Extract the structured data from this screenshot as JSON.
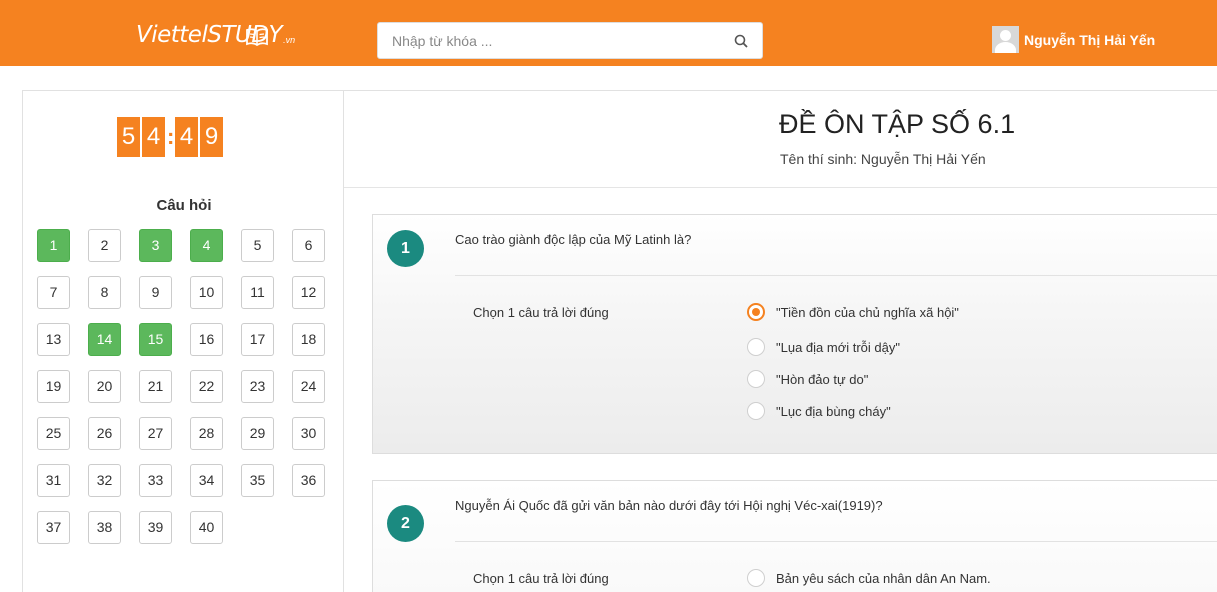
{
  "header": {
    "logo_main": "ViettelSTUDY",
    "logo_sub": ".vn",
    "search_placeholder": "Nhập từ khóa ...",
    "user_name": "Nguyễn Thị Hải Yến",
    "accent_color": "#f58220",
    "icons": [
      "book-icon",
      "search-icon",
      "avatar-icon"
    ]
  },
  "timer": {
    "d1": "5",
    "d2": "4",
    "sep": ":",
    "d3": "4",
    "d4": "9"
  },
  "question_nav": {
    "title": "Câu hỏi",
    "answered_color": "#5cb85c",
    "items": [
      {
        "n": "1",
        "done": true
      },
      {
        "n": "2",
        "done": false
      },
      {
        "n": "3",
        "done": true
      },
      {
        "n": "4",
        "done": true
      },
      {
        "n": "5",
        "done": false
      },
      {
        "n": "6",
        "done": false
      },
      {
        "n": "7",
        "done": false
      },
      {
        "n": "8",
        "done": false
      },
      {
        "n": "9",
        "done": false
      },
      {
        "n": "10",
        "done": false
      },
      {
        "n": "11",
        "done": false
      },
      {
        "n": "12",
        "done": false
      },
      {
        "n": "13",
        "done": false
      },
      {
        "n": "14",
        "done": true
      },
      {
        "n": "15",
        "done": true
      },
      {
        "n": "16",
        "done": false
      },
      {
        "n": "17",
        "done": false
      },
      {
        "n": "18",
        "done": false
      },
      {
        "n": "19",
        "done": false
      },
      {
        "n": "20",
        "done": false
      },
      {
        "n": "21",
        "done": false
      },
      {
        "n": "22",
        "done": false
      },
      {
        "n": "23",
        "done": false
      },
      {
        "n": "24",
        "done": false
      },
      {
        "n": "25",
        "done": false
      },
      {
        "n": "26",
        "done": false
      },
      {
        "n": "27",
        "done": false
      },
      {
        "n": "28",
        "done": false
      },
      {
        "n": "29",
        "done": false
      },
      {
        "n": "30",
        "done": false
      },
      {
        "n": "31",
        "done": false
      },
      {
        "n": "32",
        "done": false
      },
      {
        "n": "33",
        "done": false
      },
      {
        "n": "34",
        "done": false
      },
      {
        "n": "35",
        "done": false
      },
      {
        "n": "36",
        "done": false
      },
      {
        "n": "37",
        "done": false
      },
      {
        "n": "38",
        "done": false
      },
      {
        "n": "39",
        "done": false
      },
      {
        "n": "40",
        "done": false
      }
    ]
  },
  "exam": {
    "title": "ĐỀ ÔN TẬP SỐ 6.1",
    "student_line": "Tên thí sinh: Nguyễn Thị Hải Yến"
  },
  "questions": [
    {
      "number": "1",
      "text": "Cao trào giành độc lập của Mỹ Latinh là?",
      "instruction": "Chọn 1 câu trả lời đúng",
      "options": [
        {
          "label": "\"Tiền đồn của chủ nghĩa xã hội\"",
          "selected": true
        },
        {
          "label": "\"Lụa địa mới trỗi dậy\"",
          "selected": false
        },
        {
          "label": "\"Hòn đảo tự do\"",
          "selected": false
        },
        {
          "label": "\"Lục địa bùng cháy\"",
          "selected": false
        }
      ]
    },
    {
      "number": "2",
      "text": "Nguyễn Ái Quốc đã gửi văn bản nào dưới đây tới Hội nghị Véc-xai(1919)?",
      "instruction": "Chọn 1 câu trả lời đúng",
      "options": [
        {
          "label": "Bản yêu sách của nhân dân An Nam.",
          "selected": false
        }
      ]
    }
  ]
}
